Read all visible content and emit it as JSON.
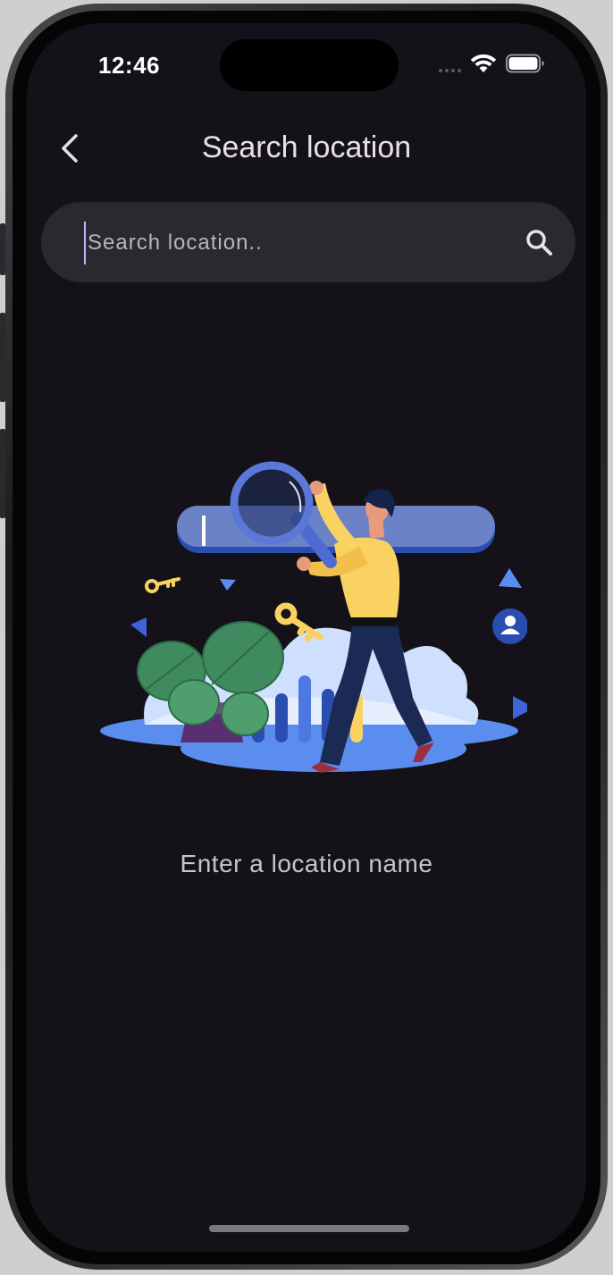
{
  "status_bar": {
    "time": "12:46"
  },
  "header": {
    "title": "Search location"
  },
  "search": {
    "placeholder": "Search location..",
    "value": ""
  },
  "empty_state": {
    "message": "Enter a location name"
  },
  "colors": {
    "background": "#141218",
    "search_bar": "#2b2930",
    "title_text": "#e6e1e8",
    "hint_text": "#c9c4cc",
    "accent_blue": "#5b8def",
    "accent_yellow": "#f9d262"
  },
  "icons": {
    "back": "chevron-left-icon",
    "search": "magnifier-icon",
    "wifi": "wifi-icon",
    "battery": "battery-icon"
  }
}
